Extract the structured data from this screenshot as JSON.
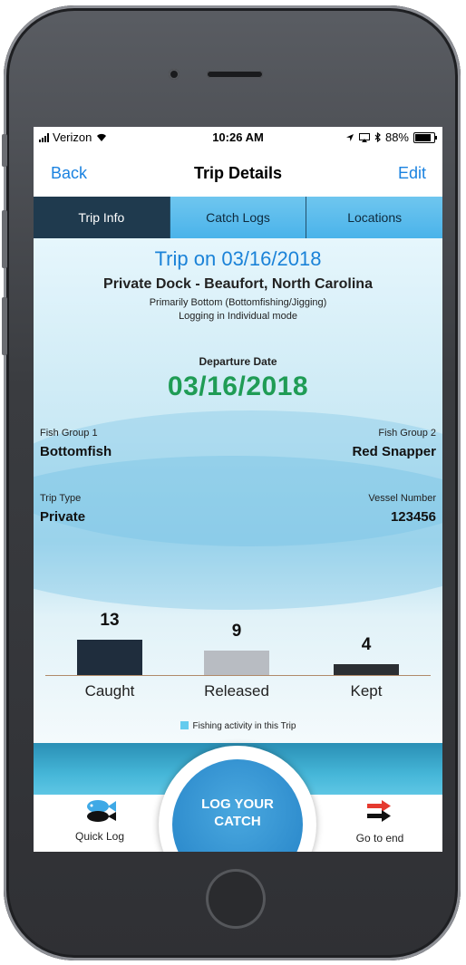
{
  "status_bar": {
    "carrier": "Verizon",
    "time": "10:26 AM",
    "battery": "88%"
  },
  "nav": {
    "back": "Back",
    "title": "Trip Details",
    "edit": "Edit"
  },
  "tabs": [
    {
      "label": "Trip Info",
      "active": true
    },
    {
      "label": "Catch Logs",
      "active": false
    },
    {
      "label": "Locations",
      "active": false
    }
  ],
  "trip": {
    "title": "Trip on 03/16/2018",
    "location": "Private Dock -  Beaufort, North Carolina",
    "method": "Primarily Bottom (Bottomfishing/Jigging)",
    "mode": "Logging in Individual mode",
    "departure_label": "Departure Date",
    "departure_date": "03/16/2018",
    "fish_group_1_label": "Fish Group 1",
    "fish_group_1": "Bottomfish",
    "fish_group_2_label": "Fish Group 2",
    "fish_group_2": "Red Snapper",
    "trip_type_label": "Trip Type",
    "trip_type": "Private",
    "vessel_label": "Vessel Number",
    "vessel_number": "123456"
  },
  "chart_data": {
    "type": "bar",
    "categories": [
      "Caught",
      "Released",
      "Kept"
    ],
    "values": [
      13,
      9,
      4
    ],
    "colors": [
      "#1f2d3d",
      "#b8bcc2",
      "#2b2f33"
    ],
    "legend": "Fishing activity in this Trip"
  },
  "bottom_bar": {
    "quick_log": "Quick Log",
    "log_catch_line1": "LOG YOUR",
    "log_catch_line2": "CATCH",
    "go_to_end": "Go to end"
  },
  "colors": {
    "accent_blue": "#1a82e0",
    "date_green": "#1f9c55",
    "tab_active": "#1f3a4e",
    "tab_inactive": "#5bbdec"
  }
}
